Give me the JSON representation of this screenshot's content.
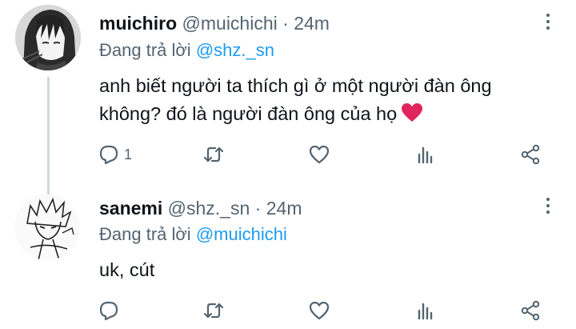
{
  "colors": {
    "link": "#1d9bf0",
    "secondary_text": "#536471",
    "primary_text": "#0f1419",
    "like": "#e0245e"
  },
  "tweets": [
    {
      "display_name": "muichiro",
      "handle": "@muichichi",
      "separator": "·",
      "time": "24m",
      "replying_prefix": "Đang trả lời",
      "replying_to": "@shz._sn",
      "text_lines": [
        "anh biết người ta thích gì ở một người đàn ông",
        "không? đó là người đàn ông của họ"
      ],
      "emoji": "red-heart",
      "reply_count": "1",
      "icons": [
        "reply-icon",
        "retweet-icon",
        "like-icon",
        "stats-icon",
        "share-icon",
        "more-icon"
      ]
    },
    {
      "display_name": "sanemi",
      "handle": "@shz._sn",
      "separator": "·",
      "time": "24m",
      "replying_prefix": "Đang trả lời",
      "replying_to": "@muichichi",
      "text_lines": [
        "uk, cút"
      ],
      "reply_count": "",
      "icons": [
        "reply-icon",
        "retweet-icon",
        "like-icon",
        "stats-icon",
        "share-icon",
        "more-icon"
      ]
    }
  ]
}
